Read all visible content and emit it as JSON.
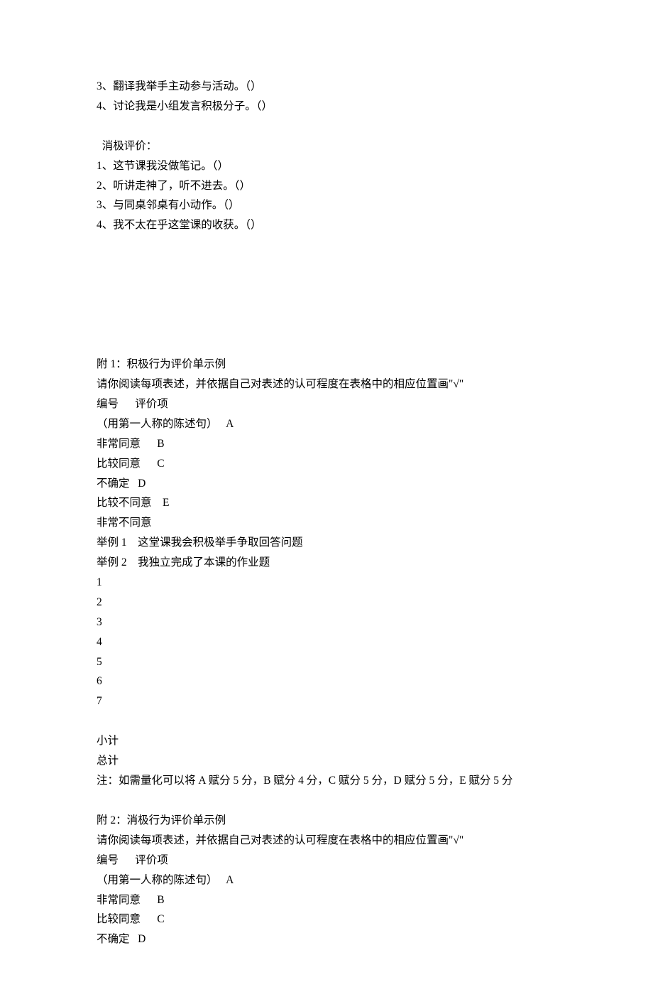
{
  "top": {
    "line1": "3、翻译我举手主动参与活动。（）",
    "line2": "4、讨论我是小组发言积极分子。（）"
  },
  "negative": {
    "heading": "  消极评价：",
    "items": [
      "1、这节课我没做笔记。（）",
      "2、听讲走神了，听不进去。（）",
      "3、与同桌邻桌有小动作。（）",
      "4、我不太在乎这堂课的收获。（）"
    ]
  },
  "appendix1": {
    "title": "附 1：积极行为评价单示例",
    "instruction": "请你阅读每项表述，并依据自己对表述的认可程度在表格中的相应位置画\"√\"",
    "header_line": "编号      评价项",
    "note_statement": "（用第一人称的陈述句）   A",
    "options": [
      "非常同意      B",
      "比较同意      C",
      "不确定   D",
      "比较不同意    E",
      "非常不同意"
    ],
    "examples": [
      "举例 1    这堂课我会积极举手争取回答问题",
      "举例 2    我独立完成了本课的作业题"
    ],
    "numbers": [
      "1",
      "2",
      "3",
      "4",
      "5",
      "6",
      "7"
    ],
    "subtotal": "小计",
    "total": "总计",
    "footnote": "注：如需量化可以将 A 赋分 5 分，B 赋分 4 分，C 赋分 5 分，D 赋分 5 分，E 赋分 5 分"
  },
  "appendix2": {
    "title": "附 2：消极行为评价单示例",
    "instruction": "请你阅读每项表述，并依据自己对表述的认可程度在表格中的相应位置画\"√\"",
    "header_line": "编号      评价项",
    "note_statement": "（用第一人称的陈述句）   A",
    "options": [
      "非常同意      B",
      "比较同意      C",
      "不确定   D"
    ]
  }
}
